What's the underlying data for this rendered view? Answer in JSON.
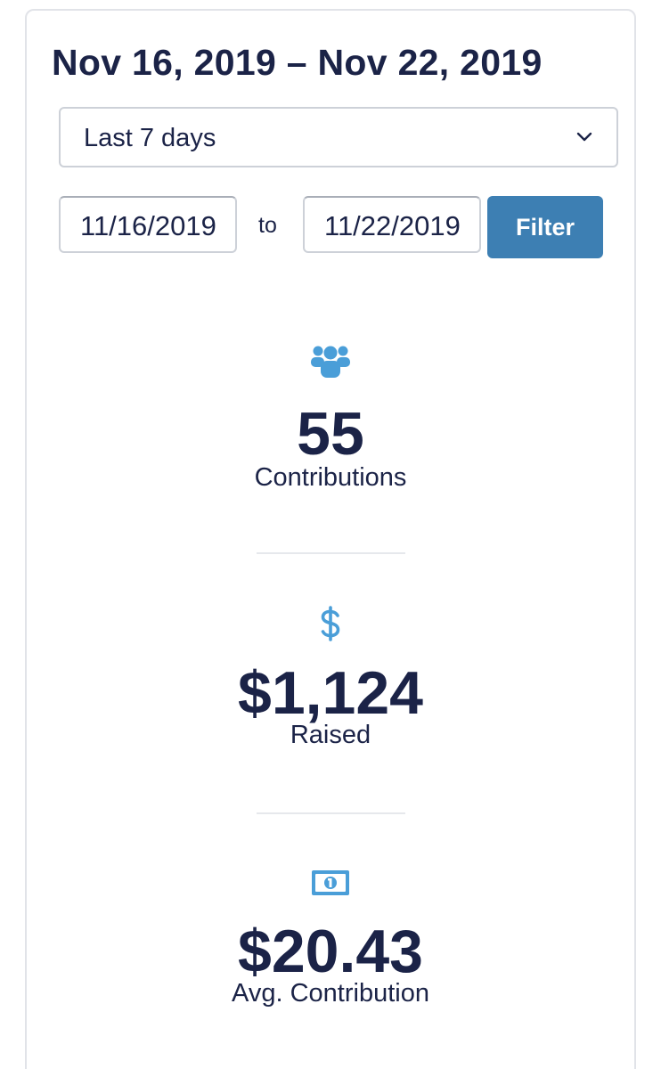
{
  "header": {
    "title": "Nov 16, 2019 – Nov 22, 2019"
  },
  "filters": {
    "range_select": {
      "selected": "Last 7 days",
      "icon": "chevron-down-icon"
    },
    "date_from": "11/16/2019",
    "to_label": "to",
    "date_to": "11/22/2019",
    "filter_button": "Filter"
  },
  "stats": {
    "contributions": {
      "icon": "users-icon",
      "value": "55",
      "label": "Contributions"
    },
    "raised": {
      "icon": "dollar-icon",
      "value": "$1,124",
      "label": "Raised"
    },
    "average": {
      "icon": "money-bill-icon",
      "value": "$20.43",
      "label": "Avg. Contribution"
    }
  },
  "colors": {
    "text": "#1b2347",
    "accent_icon": "#4a9ed8",
    "button": "#3d7fb3",
    "border": "#cdd1d8"
  }
}
